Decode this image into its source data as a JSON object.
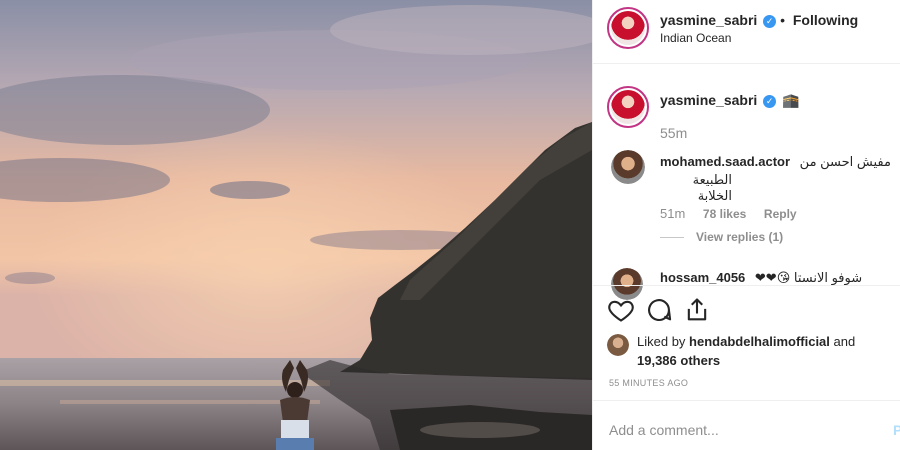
{
  "header": {
    "username": "yasmine_sabri",
    "separator": "•",
    "follow_label": "Following",
    "location": "Indian Ocean"
  },
  "caption": {
    "username": "yasmine_sabri",
    "emoji": "🕋",
    "time": "55m"
  },
  "comment": {
    "username": "mohamed.saad.actor",
    "text_line1": "مفيش احسن من",
    "text_line2": "الطبيعة الخلابة",
    "time": "51m",
    "likes": "78 likes",
    "reply_label": "Reply",
    "view_replies": "View replies (1)"
  },
  "comment2": {
    "username": "hossam_4056",
    "text": "شوفو الانستا 😘❤❤"
  },
  "actions": {
    "like_icon": "heart-icon",
    "comment_icon": "comment-icon",
    "share_icon": "share-icon"
  },
  "likes": {
    "prefix": "Liked by",
    "user": "hendabdelhalimofficial",
    "and": "and",
    "count": "19,386 others"
  },
  "post_date": "55 MINUTES AGO",
  "add_comment": {
    "placeholder": "Add a comment...",
    "post_label": "P"
  },
  "colors": {
    "verified": "#3897f0",
    "muted": "#8e8e8e",
    "ring": "#c13584"
  }
}
